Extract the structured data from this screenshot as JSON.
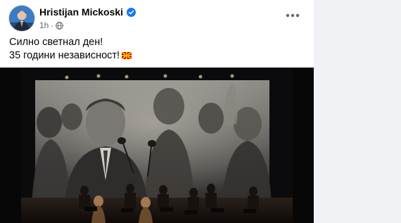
{
  "post": {
    "author": "Hristijan Mickoski",
    "time": "1h",
    "separator": "·",
    "text_lines": [
      "Силно светнал ден!",
      "35 години независност!"
    ],
    "flag_emoji": "flag-north-macedonia",
    "more_icon": "more-horizontal-icon",
    "privacy_icon": "globe-icon"
  },
  "colors": {
    "verified": "#1877f2",
    "author_text": "#050505",
    "meta_text": "#65676b",
    "page_background": "#f0f2f5"
  }
}
